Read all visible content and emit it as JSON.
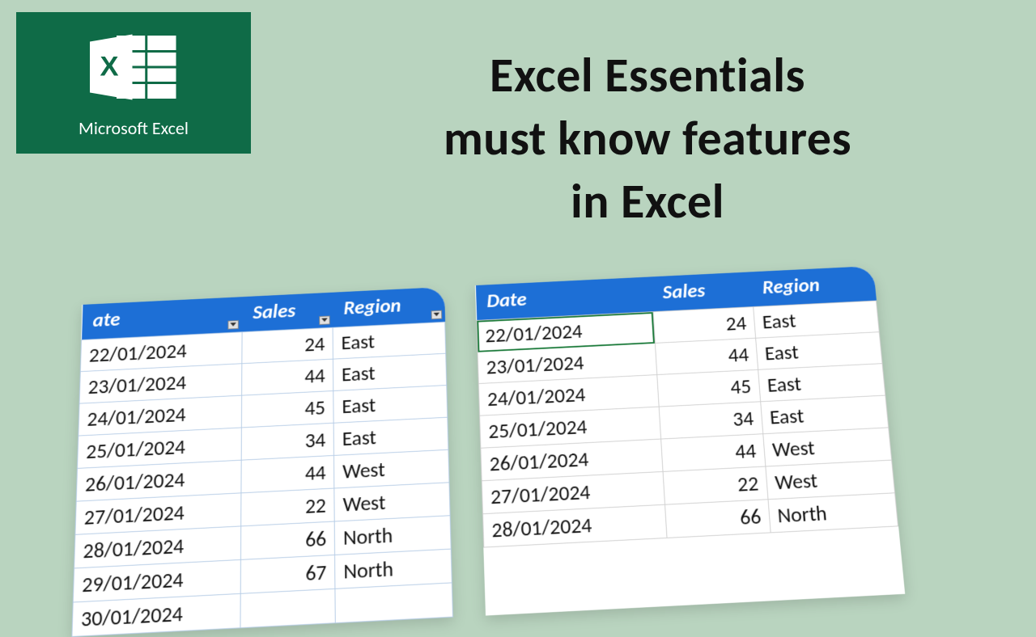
{
  "branding": {
    "product_name": "Microsoft Excel",
    "accent_color": "#0f6b47",
    "logo_bg": "#0f6b47"
  },
  "headline": {
    "line1": "Excel Essentials",
    "line2": "must know features",
    "line3": "in Excel"
  },
  "table": {
    "headers": {
      "date": "Date",
      "sales": "Sales",
      "region": "Region"
    },
    "left_headers_clipped": {
      "date_partial": "ate",
      "sales": "Sales",
      "region": "Region"
    },
    "rows_left": [
      {
        "date": "22/01/2024",
        "sales": 24,
        "region": "East"
      },
      {
        "date": "23/01/2024",
        "sales": 44,
        "region": "East"
      },
      {
        "date": "24/01/2024",
        "sales": 45,
        "region": "East"
      },
      {
        "date": "25/01/2024",
        "sales": 34,
        "region": "East"
      },
      {
        "date": "26/01/2024",
        "sales": 44,
        "region": "West"
      },
      {
        "date": "27/01/2024",
        "sales": 22,
        "region": "West"
      },
      {
        "date": "28/01/2024",
        "sales": 66,
        "region": "North"
      },
      {
        "date": "29/01/2024",
        "sales": 67,
        "region": "North"
      },
      {
        "date": "30/01/2024",
        "sales": "",
        "region": ""
      }
    ],
    "rows_right": [
      {
        "date": "22/01/2024",
        "sales": 24,
        "region": "East"
      },
      {
        "date": "23/01/2024",
        "sales": 44,
        "region": "East"
      },
      {
        "date": "24/01/2024",
        "sales": 45,
        "region": "East"
      },
      {
        "date": "25/01/2024",
        "sales": 34,
        "region": "East"
      },
      {
        "date": "26/01/2024",
        "sales": 44,
        "region": "West"
      },
      {
        "date": "27/01/2024",
        "sales": 22,
        "region": "West"
      },
      {
        "date": "28/01/2024",
        "sales": 66,
        "region": "North"
      }
    ]
  }
}
